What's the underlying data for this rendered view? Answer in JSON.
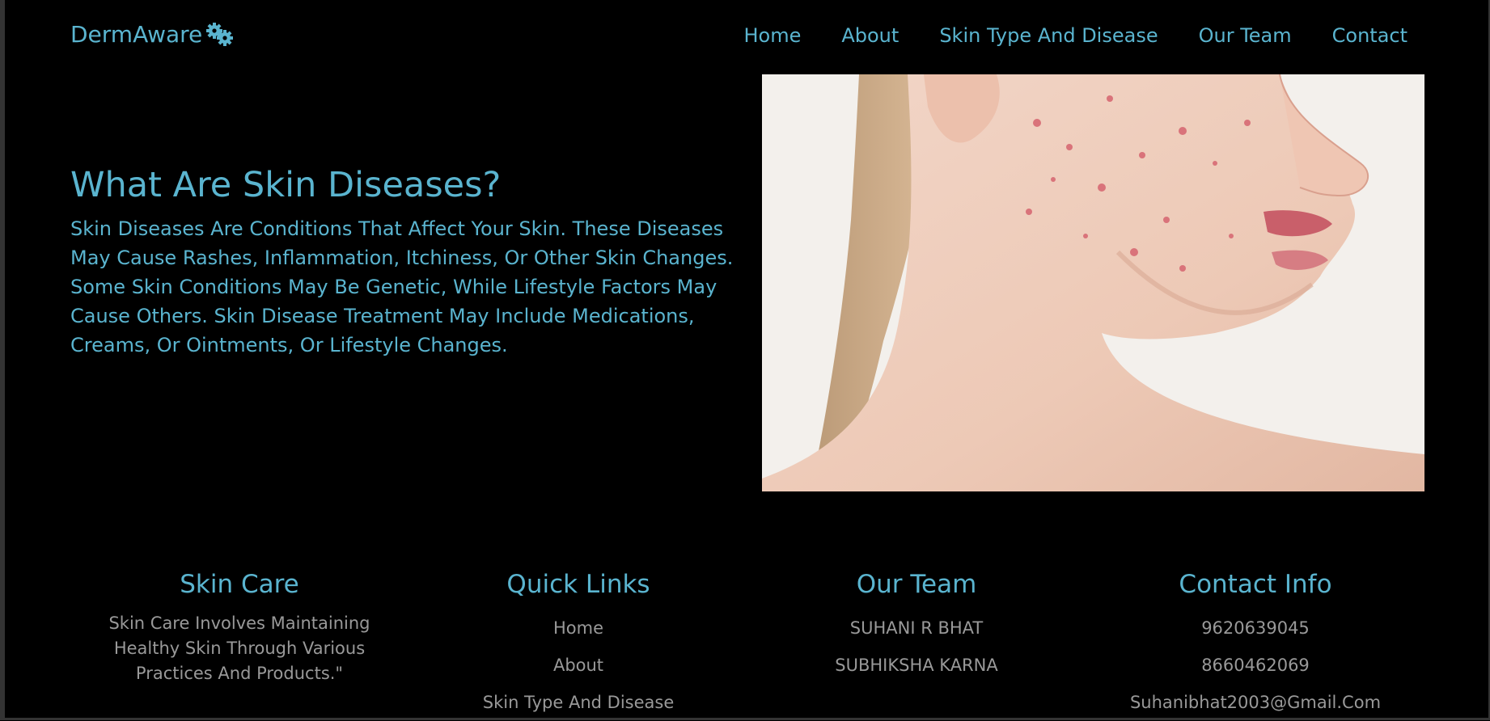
{
  "header": {
    "logo_text": "DermAware",
    "logo_icon": "gears-icon",
    "nav": [
      "Home",
      "About",
      "Skin Type And Disease",
      "Our Team",
      "Contact"
    ]
  },
  "hero": {
    "title": "What Are Skin Diseases?",
    "text": "Skin Diseases Are Conditions That Affect Your Skin. These Diseases May Cause Rashes, Inflammation, Itchiness, Or Other Skin Changes. Some Skin Conditions May Be Genetic, While Lifestyle Factors May Cause Others. Skin Disease Treatment May Include Medications, Creams, Or Ointments, Or Lifestyle Changes."
  },
  "footer": {
    "skin_care": {
      "title": "Skin Care",
      "text": "Skin Care Involves Maintaining Healthy Skin Through Various Practices And Products.\""
    },
    "quick_links": {
      "title": "Quick Links",
      "links": [
        "Home",
        "About",
        "Skin Type And Disease"
      ]
    },
    "our_team": {
      "title": "Our Team",
      "members": [
        "SUHANI R BHAT",
        "SUBHIKSHA KARNA"
      ]
    },
    "contact": {
      "title": "Contact Info",
      "items": [
        "9620639045",
        "8660462069",
        "Suhanibhat2003@Gmail.Com"
      ]
    }
  },
  "colors": {
    "accent": "#5ab4cf",
    "background": "#000000",
    "muted_text": "#999999"
  }
}
